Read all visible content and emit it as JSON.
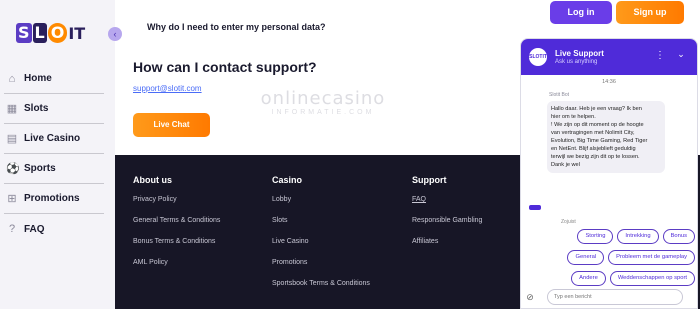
{
  "brand": {
    "logo_letters": [
      "S",
      "L",
      "O"
    ],
    "logo_suffix": "IT",
    "collapse_icon": "chevron-left-icon",
    "collapse_glyph": "‹"
  },
  "sidebar": {
    "items": [
      {
        "label": "Home",
        "icon": "home-icon",
        "glyph": "⌂"
      },
      {
        "label": "Slots",
        "icon": "slots-icon",
        "glyph": "▦"
      },
      {
        "label": "Live Casino",
        "icon": "live-casino-icon",
        "glyph": "▤"
      },
      {
        "label": "Sports",
        "icon": "sports-icon",
        "glyph": "⚽"
      },
      {
        "label": "Promotions",
        "icon": "promotions-icon",
        "glyph": "⊞"
      },
      {
        "label": "FAQ",
        "icon": "faq-icon",
        "glyph": "?"
      }
    ]
  },
  "header": {
    "login_label": "Log in",
    "signup_label": "Sign up"
  },
  "main": {
    "faq_question": "Why do I need to enter my personal data?",
    "contact_heading": "How can I contact support?",
    "support_email": "support@slotit.com",
    "live_chat_label": "Live Chat"
  },
  "watermark": {
    "main": "onlinecasino",
    "sub": "INFORMATIE.COM"
  },
  "footer": {
    "columns": [
      {
        "heading": "About us",
        "links": [
          "Privacy Policy",
          "General Terms & Conditions",
          "Bonus Terms & Conditions",
          "AML Policy"
        ]
      },
      {
        "heading": "Casino",
        "links": [
          "Lobby",
          "Slots",
          "Live Casino",
          "Promotions",
          "Sportsbook Terms & Conditions"
        ]
      },
      {
        "heading": "Support",
        "links": [
          "FAQ",
          "Responsible Gambling",
          "Affiliates"
        ]
      }
    ]
  },
  "chat": {
    "avatar_text": "SLOTIT",
    "title": "Live Support",
    "subtitle": "Ask us anything",
    "menu_glyph": "⋮",
    "minimize_glyph": "⌄",
    "time": "14:36",
    "sender": "Slotit Bot",
    "message_lines": [
      "Hallo daar. Heb je een vraag? Ik ben",
      "hier om te helpen.",
      "! We zijn op dit moment op de hoogte",
      "van vertragingen met Nolimit City,",
      "Evolution, Big Time Gaming, Red Tiger",
      "en NetEnt. Blijf alsjeblieft geduldig",
      "terwijl we bezig zijn dit op te lossen.",
      "Dank je wel"
    ],
    "status": "Zojuist",
    "quick_replies": [
      [
        "Storting",
        "Intrekking",
        "Bonus"
      ],
      [
        "General",
        "Probleem met de gameplay"
      ],
      [
        "Andere",
        "Weddenschappen op sport"
      ]
    ],
    "input_placeholder": "Typ een bericht",
    "attach_glyph": "⊘"
  }
}
